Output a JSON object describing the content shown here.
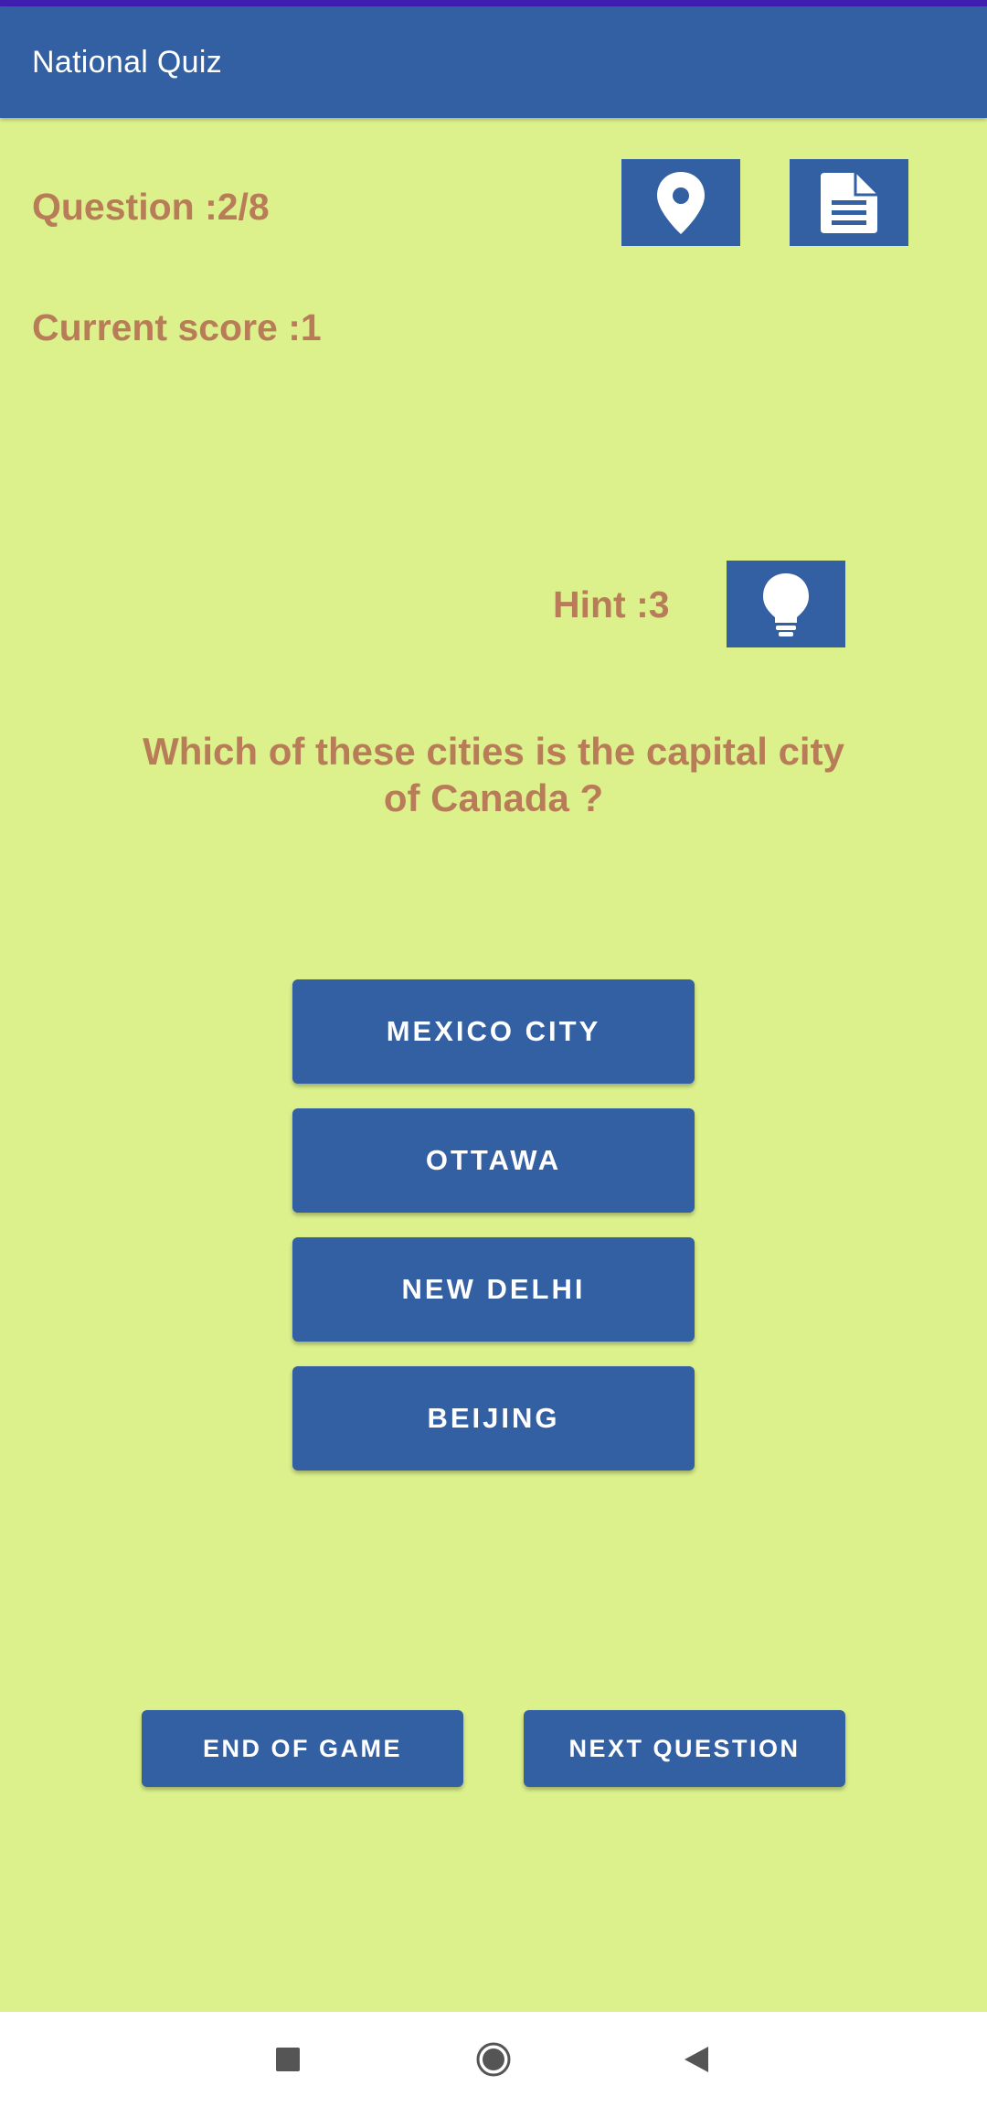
{
  "app": {
    "title": "National Quiz"
  },
  "colors": {
    "background": "#dcf18c",
    "primary": "#335fa3",
    "status_strip": "#3f1fb0",
    "info_text": "#b87d58"
  },
  "quiz": {
    "question_counter": "Question :2/8",
    "current_score": "Current score :1",
    "hint_count": "Hint :3",
    "question_text": "Which of these cities is the capital city of Canada ?"
  },
  "toolbar": {
    "map_button_icon": "map-pin-icon",
    "notes_button_icon": "document-icon",
    "hint_button_icon": "lightbulb-icon"
  },
  "answers": [
    {
      "label": "MEXICO CITY"
    },
    {
      "label": "OTTAWA"
    },
    {
      "label": "NEW DELHI"
    },
    {
      "label": "BEIJING"
    }
  ],
  "actions": {
    "end_game_label": "END OF GAME",
    "next_question_label": "NEXT QUESTION"
  },
  "navigation": {
    "recents_icon": "square-icon",
    "home_icon": "circle-icon",
    "back_icon": "triangle-back-icon"
  }
}
